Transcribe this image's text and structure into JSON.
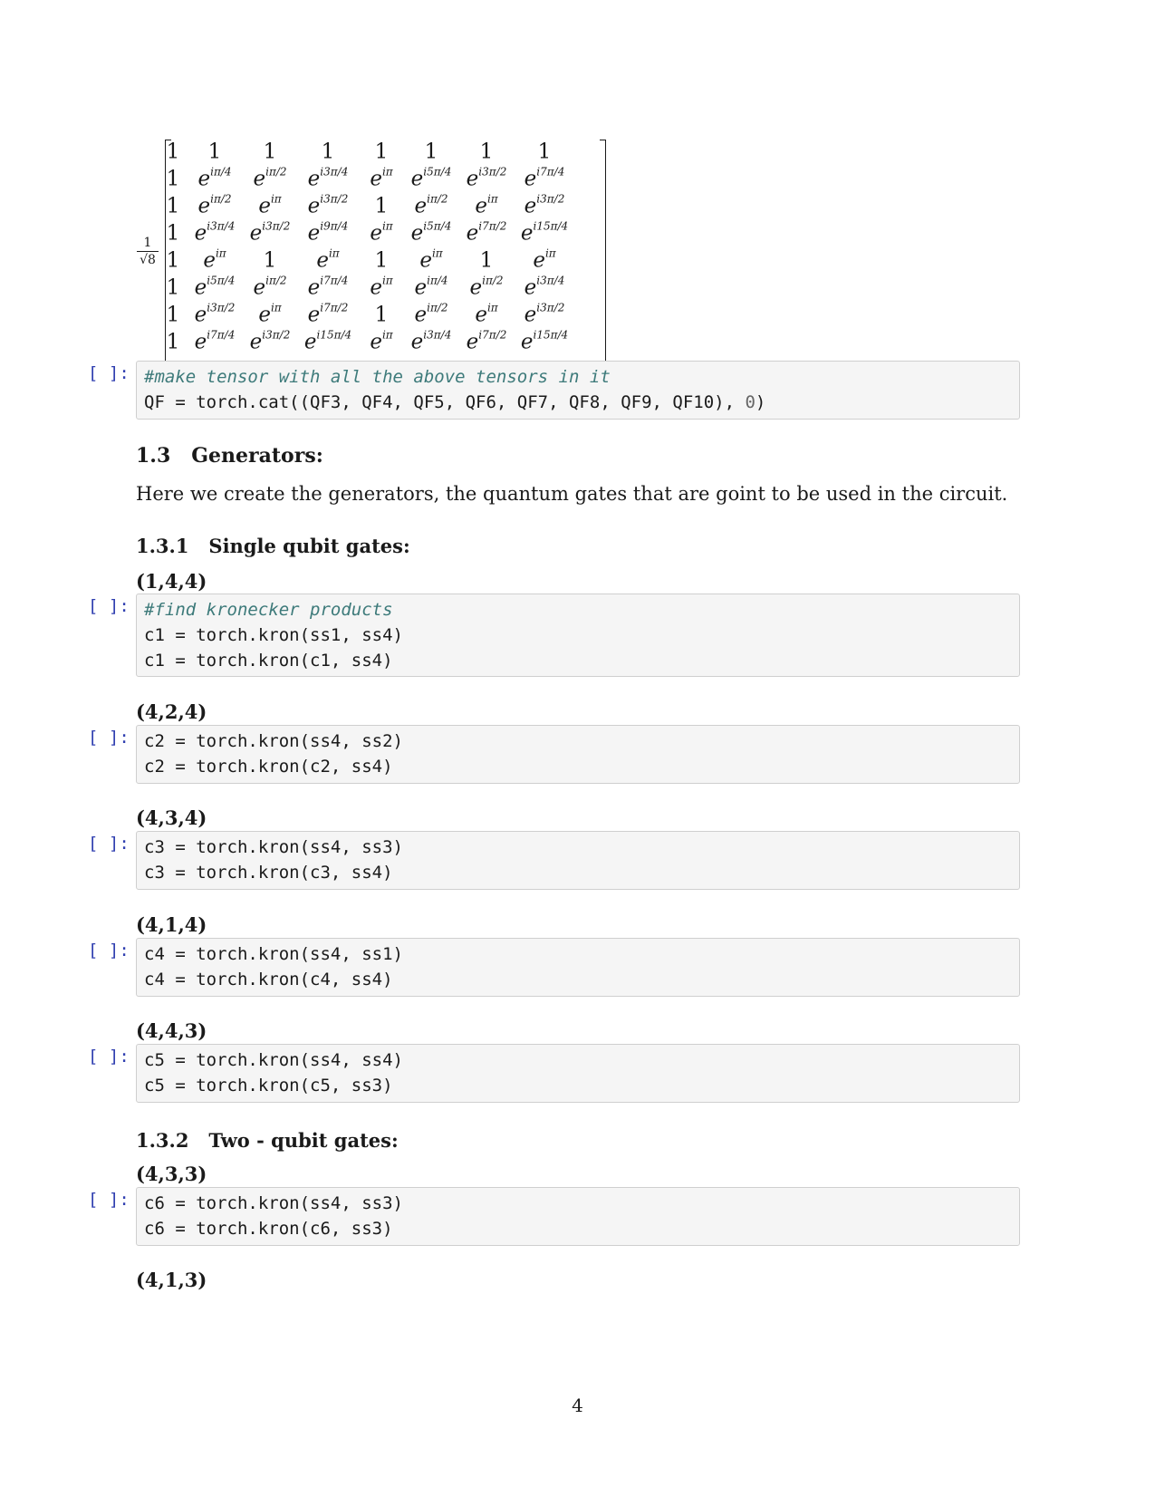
{
  "matrix": {
    "prefactor_num": "1",
    "prefactor_den": "√8",
    "rows": [
      [
        "1",
        "1",
        "1",
        "1",
        "1",
        "1",
        "1",
        "1"
      ],
      [
        "1",
        "iπ/4",
        "iπ/2",
        "i3π/4",
        "iπ",
        "i5π/4",
        "i3π/2",
        "i7π/4"
      ],
      [
        "1",
        "iπ/2",
        "iπ",
        "i3π/2",
        "1",
        "iπ/2",
        "iπ",
        "i3π/2"
      ],
      [
        "1",
        "i3π/4",
        "i3π/2",
        "i9π/4",
        "iπ",
        "i5π/4",
        "i7π/2",
        "i15π/4"
      ],
      [
        "1",
        "iπ",
        "1",
        "iπ",
        "1",
        "iπ",
        "1",
        "iπ"
      ],
      [
        "1",
        "i5π/4",
        "iπ/2",
        "i7π/4",
        "iπ",
        "iπ/4",
        "iπ/2",
        "i3π/4"
      ],
      [
        "1",
        "i3π/2",
        "iπ",
        "i7π/2",
        "1",
        "iπ/2",
        "iπ",
        "i3π/2"
      ],
      [
        "1",
        "i7π/4",
        "i3π/2",
        "i15π/4",
        "iπ",
        "i3π/4",
        "i7π/2",
        "i15π/4"
      ]
    ]
  },
  "prompt": "[ ]:",
  "cells": {
    "c0": {
      "comment": "#make tensor with all the above tensors in it",
      "line2_a": "QF = torch.cat((QF3, QF4, QF5, QF6, QF7, QF8, QF9, QF10), ",
      "line2_num": "0",
      "line2_b": ")"
    },
    "c1": {
      "comment": "#find kronecker products",
      "line2": "c1 = torch.kron(ss1, ss4)",
      "line3": "c1 = torch.kron(c1, ss4)"
    },
    "c2": {
      "line1": "c2 = torch.kron(ss4, ss2)",
      "line2": "c2 = torch.kron(c2, ss4)"
    },
    "c3": {
      "line1": "c3 = torch.kron(ss4, ss3)",
      "line2": "c3 = torch.kron(c3, ss4)"
    },
    "c4": {
      "line1": "c4 = torch.kron(ss4, ss1)",
      "line2": "c4 = torch.kron(c4, ss4)"
    },
    "c5": {
      "line1": "c5 = torch.kron(ss4, ss4)",
      "line2": "c5 = torch.kron(c5, ss3)"
    },
    "c6": {
      "line1": "c6 = torch.kron(ss4, ss3)",
      "line2": "c6 = torch.kron(c6, ss3)"
    }
  },
  "section": {
    "number": "1.3",
    "title": "Generators:"
  },
  "intro": "Here we create the generators, the quantum gates that are goint to be used in the circuit.",
  "sub1": {
    "number": "1.3.1",
    "title": "Single qubit gates:"
  },
  "sub2": {
    "number": "1.3.2",
    "title": "Two - qubit gates:"
  },
  "labels": {
    "l1": "(1,4,4)",
    "l2": "(4,2,4)",
    "l3": "(4,3,4)",
    "l4": "(4,1,4)",
    "l5": "(4,4,3)",
    "l6": "(4,3,3)",
    "l7": "(4,1,3)"
  },
  "page_number": "4"
}
